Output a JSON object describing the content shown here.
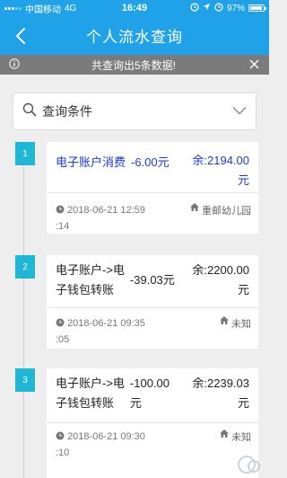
{
  "status_bar": {
    "carrier": "中国移动",
    "network": "4G",
    "time": "16:49",
    "battery": "97%"
  },
  "nav": {
    "title": "个人流水查询"
  },
  "notice": {
    "text": "共查询出5条数据!"
  },
  "search": {
    "label": "查询条件"
  },
  "records": [
    {
      "index": "1",
      "desc": "电子账户消费",
      "amount": "-6.00元",
      "balance_line1": "余:2194.00",
      "balance_line2": "元",
      "time_line1": "2018-06-21 12:59",
      "time_line2": ":14",
      "location": "重邮幼儿园"
    },
    {
      "index": "2",
      "desc_line1": "电子账户->电",
      "desc_line2": "子钱包转账",
      "amount": "-39.03元",
      "balance_line1": "余:2200.00",
      "balance_line2": "元",
      "time_line1": "2018-06-21 09:35",
      "time_line2": ":05",
      "location": "未知"
    },
    {
      "index": "3",
      "desc_line1": "电子账户->电",
      "desc_line2": "子钱包转账",
      "amount_line1": "-100.00",
      "amount_line2": "元",
      "balance_line1": "余:2239.03",
      "balance_line2": "元",
      "time_line1": "2018-06-21 09:30",
      "time_line2": ":10",
      "location": "未知"
    }
  ],
  "colors": {
    "header": "#1fa2e8",
    "badge": "#1fb7d6",
    "highlight_text": "#1f3ad6",
    "notice_bg": "#7b7b7b"
  }
}
